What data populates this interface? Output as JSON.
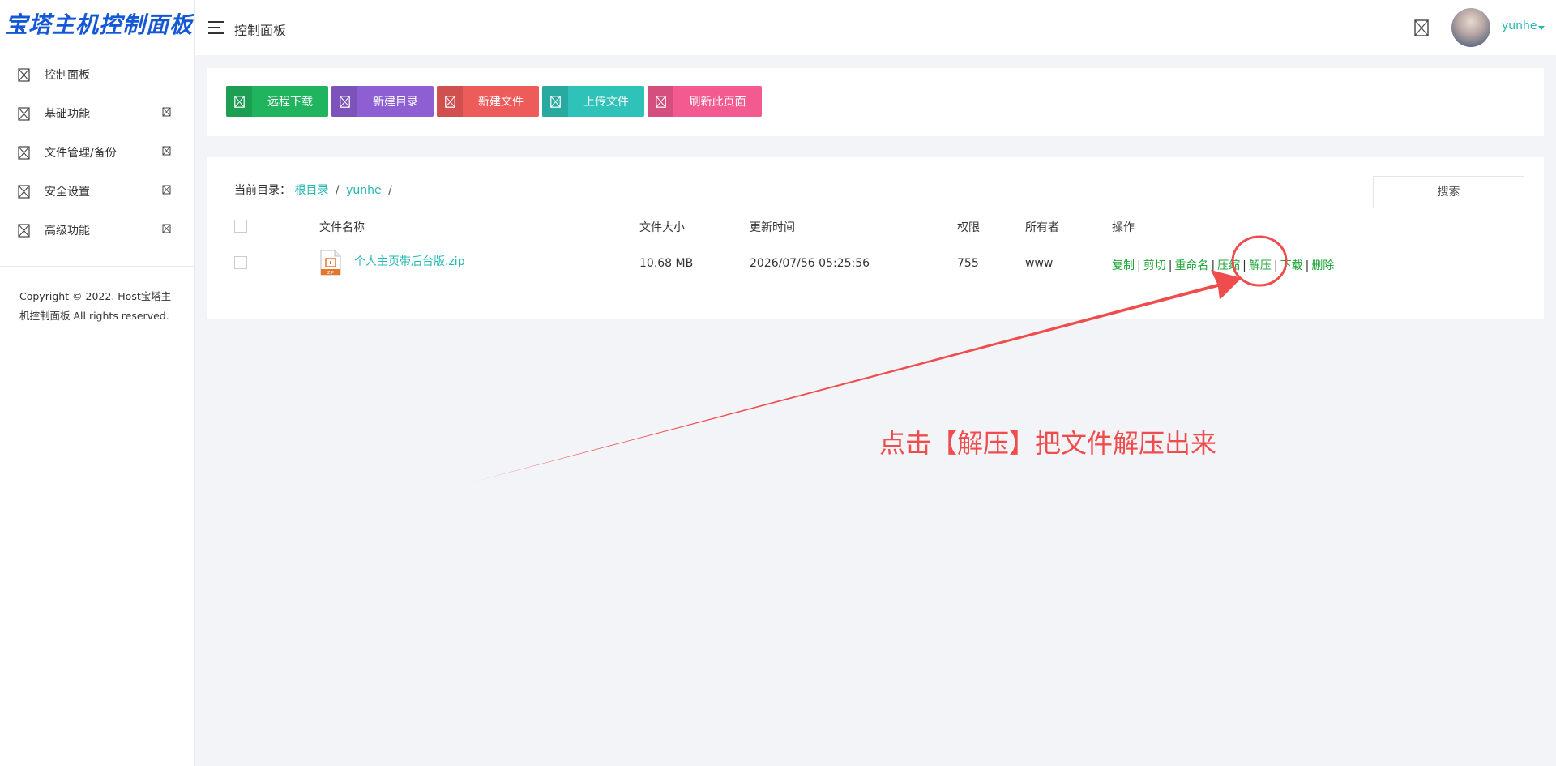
{
  "app": {
    "logo": "宝塔主机控制面板"
  },
  "header": {
    "title": "控制面板",
    "username": "yunhe"
  },
  "sidebar": {
    "items": [
      {
        "label": "控制面板",
        "has_arrow": false
      },
      {
        "label": "基础功能",
        "has_arrow": true
      },
      {
        "label": "文件管理/备份",
        "has_arrow": true
      },
      {
        "label": "安全设置",
        "has_arrow": true
      },
      {
        "label": "高级功能",
        "has_arrow": true
      }
    ],
    "copyright": "Copyright © 2022. Host宝塔主机控制面板 All rights reserved."
  },
  "toolbar": {
    "buttons": [
      {
        "label": "远程下载",
        "color": "#20b45f"
      },
      {
        "label": "新建目录",
        "color": "#8d5fd3"
      },
      {
        "label": "新建文件",
        "color": "#ed5b5b"
      },
      {
        "label": "上传文件",
        "color": "#2ec2b8"
      },
      {
        "label": "刷新此页面",
        "color": "#f25a90"
      }
    ]
  },
  "breadcrumb": {
    "prefix": "当前目录：",
    "root": "根目录",
    "folder": "yunhe",
    "sep": "/"
  },
  "search": {
    "label": "搜索"
  },
  "table": {
    "headers": [
      "文件名称",
      "文件大小",
      "更新时间",
      "权限",
      "所有者",
      "操作"
    ],
    "rows": [
      {
        "name": "个人主页带后台版.zip",
        "size": "10.68 MB",
        "time": "2026/07/56 05:25:56",
        "perm": "755",
        "owner": "www",
        "ops": [
          "复制",
          "剪切",
          "重命名",
          "压缩",
          "解压",
          "下载",
          "删除"
        ]
      }
    ]
  },
  "annotation": {
    "text": "点击【解压】把文件解压出来",
    "color": "#ef4d4d"
  }
}
